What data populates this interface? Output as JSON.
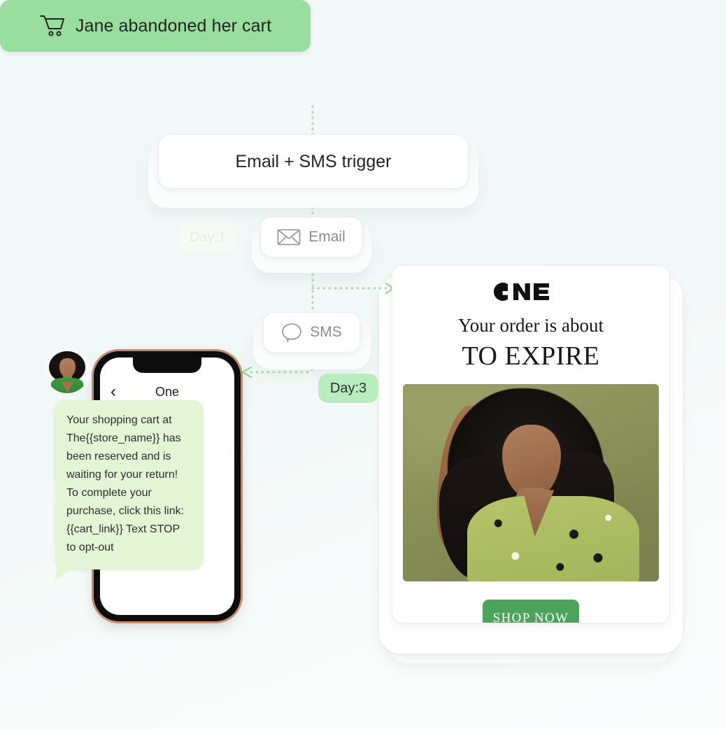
{
  "theme": {
    "accent_green": "#9ade9f",
    "pill_green": "#b9edbf",
    "sms_bubble_green": "#e4f5d6",
    "shop_button_green": "#4ca45c",
    "background": "#f2f8f8"
  },
  "flow": {
    "event": {
      "icon": "shopping-cart-icon",
      "label": "Jane abandoned her cart"
    },
    "trigger": {
      "label": "Email + SMS trigger"
    },
    "steps": [
      {
        "icon": "envelope-icon",
        "label": "Email",
        "day_badge": "Day:1"
      },
      {
        "icon": "chat-bubble-icon",
        "label": "SMS",
        "day_badge": "Day:3"
      }
    ],
    "day_badges": {
      "day1": "Day:1",
      "day3": "Day:3"
    }
  },
  "email_preview": {
    "brand_logo_text": "ONE",
    "headline_line1": "Your order is about",
    "headline_line2": "TO EXPIRE",
    "photo_alt": "model-photo",
    "cta_label": "SHOP NOW"
  },
  "phone_preview": {
    "back_icon": "chevron-left-icon",
    "conversation_title": "One",
    "message": "Your shopping cart at The{{store_name}} has been reserved and is waiting for your return! To complete your purchase, click this link: {{cart_link}} Text STOP to opt-out",
    "avatar_alt": "contact-avatar"
  }
}
